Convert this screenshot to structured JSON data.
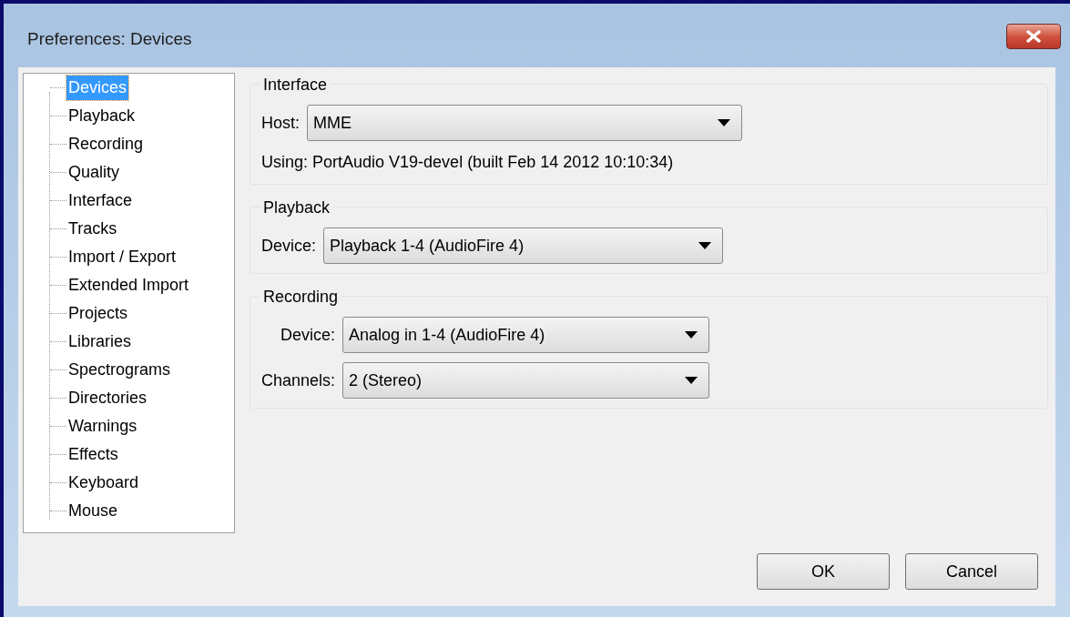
{
  "window": {
    "title": "Preferences: Devices"
  },
  "tree": {
    "items": [
      {
        "label": "Devices",
        "selected": true
      },
      {
        "label": "Playback",
        "selected": false
      },
      {
        "label": "Recording",
        "selected": false
      },
      {
        "label": "Quality",
        "selected": false
      },
      {
        "label": "Interface",
        "selected": false
      },
      {
        "label": "Tracks",
        "selected": false
      },
      {
        "label": "Import / Export",
        "selected": false
      },
      {
        "label": "Extended Import",
        "selected": false
      },
      {
        "label": "Projects",
        "selected": false
      },
      {
        "label": "Libraries",
        "selected": false
      },
      {
        "label": "Spectrograms",
        "selected": false
      },
      {
        "label": "Directories",
        "selected": false
      },
      {
        "label": "Warnings",
        "selected": false
      },
      {
        "label": "Effects",
        "selected": false
      },
      {
        "label": "Keyboard",
        "selected": false
      },
      {
        "label": "Mouse",
        "selected": false
      }
    ]
  },
  "groups": [
    {
      "title": "Interface",
      "fields": [
        {
          "kind": "dropdown",
          "label": "Host:",
          "value": "MME"
        },
        {
          "kind": "text",
          "text": "Using: PortAudio V19-devel (built Feb 14 2012 10:10:34)"
        }
      ]
    },
    {
      "title": "Playback",
      "fields": [
        {
          "kind": "dropdown",
          "label": "Device:",
          "value": "Playback 1-4 (AudioFire 4)"
        }
      ]
    },
    {
      "title": "Recording",
      "fields": [
        {
          "kind": "dropdown",
          "label": "Device:",
          "value": "Analog in 1-4 (AudioFire 4)"
        },
        {
          "kind": "dropdown",
          "label": "Channels:",
          "value": "2 (Stereo)"
        }
      ]
    }
  ],
  "buttons": [
    "OK",
    "Cancel"
  ]
}
